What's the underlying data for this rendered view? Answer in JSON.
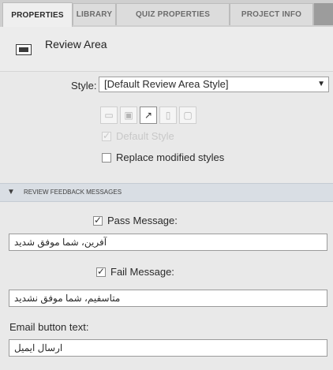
{
  "tabs": [
    "PROPERTIES",
    "LIBRARY",
    "QUIZ PROPERTIES",
    "PROJECT INFO"
  ],
  "header": {
    "title": "Review Area"
  },
  "style": {
    "label": "Style:",
    "selected": "[Default Review Area Style]",
    "default_style_label": "Default Style",
    "replace_label": "Replace modified styles"
  },
  "section": {
    "title": "REVIEW FEEDBACK MESSAGES"
  },
  "pass": {
    "label": "Pass Message:",
    "value": "آفرین، شما موفق شدید"
  },
  "fail": {
    "label": "Fail Message:",
    "value": "متاسفیم، شما موفق نشدید"
  },
  "email": {
    "label": "Email button text:",
    "value": "ارسال ایمیل"
  }
}
